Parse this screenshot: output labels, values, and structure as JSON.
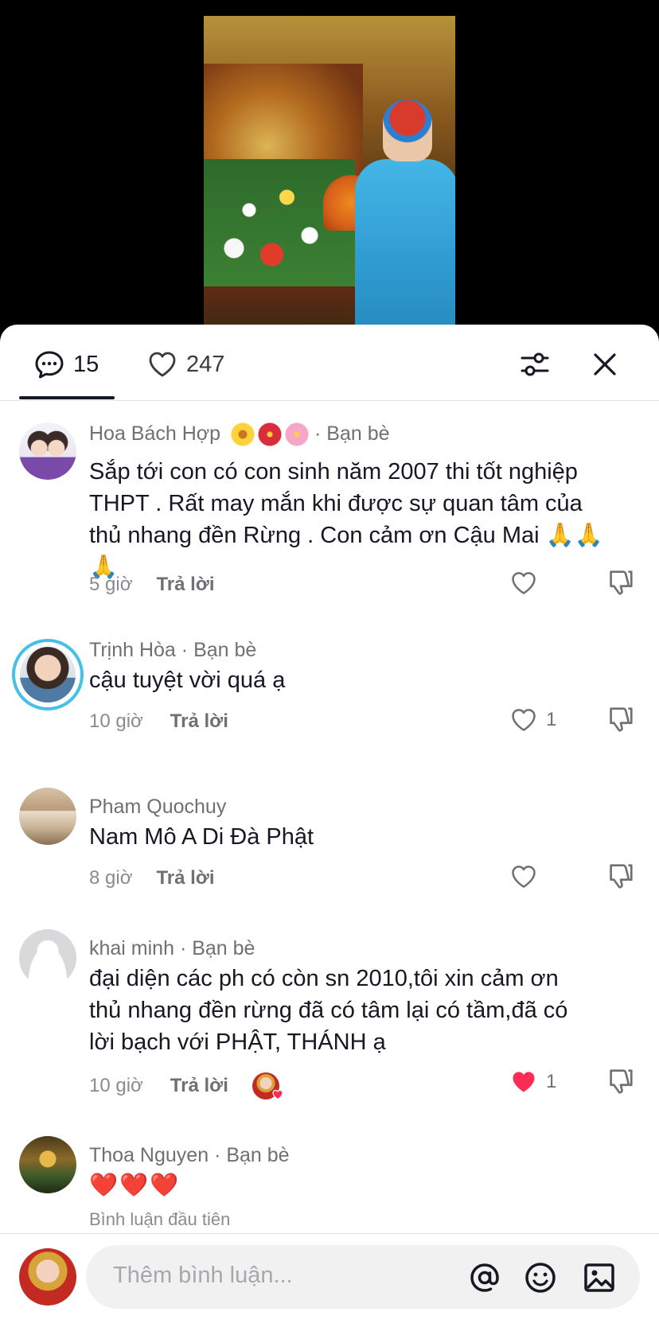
{
  "header": {
    "comments_count": "15",
    "likes_count": "247"
  },
  "comments": [
    {
      "name": "Hoa Bách Hợp",
      "badge": "· Bạn bè",
      "text_lines": [
        "Sắp tới con có con sinh năm 2007 thi tốt nghiệp",
        "THPT . Rất may mắn khi được sự quan tâm của",
        "thủ nhang đền Rừng . Con cảm ơn Cậu Mai 🙏🙏",
        "🙏"
      ],
      "time": "5 giờ",
      "reply": "Trả lời",
      "likes": ""
    },
    {
      "name": "Trịnh Hòa",
      "badge": "· Bạn bè",
      "text_lines": [
        "cậu tuyệt vời quá ạ"
      ],
      "time": "10 giờ",
      "reply": "Trả lời",
      "likes": "1"
    },
    {
      "name": "Pham Quochuy",
      "badge": "",
      "text_lines": [
        "Nam Mô A Di Đà Phật"
      ],
      "time": "8 giờ",
      "reply": "Trả lời",
      "likes": ""
    },
    {
      "name": "khai minh",
      "badge": "· Bạn bè",
      "text_lines": [
        "đại diện các ph có còn sn 2010,tôi xin cảm ơn",
        "thủ nhang đền rừng đã có tâm lại có tầm,đã có",
        "lời bạch với PHẬT, THÁNH ạ"
      ],
      "time": "10 giờ",
      "reply": "Trả lời",
      "likes": "1"
    },
    {
      "name": "Thoa Nguyen",
      "badge": "· Bạn bè",
      "text_lines": [
        "❤️❤️❤️"
      ],
      "sub": "Bình luận đầu tiên"
    }
  ],
  "composer": {
    "placeholder": "Thêm bình luận..."
  },
  "colors": {
    "like_red": "#fe2c55",
    "ring_blue": "#45c0e6"
  },
  "icons": [
    "comment-icon",
    "heart-icon",
    "filter-icon",
    "close-icon",
    "dislike-icon",
    "at-icon",
    "emoji-icon",
    "image-icon"
  ]
}
